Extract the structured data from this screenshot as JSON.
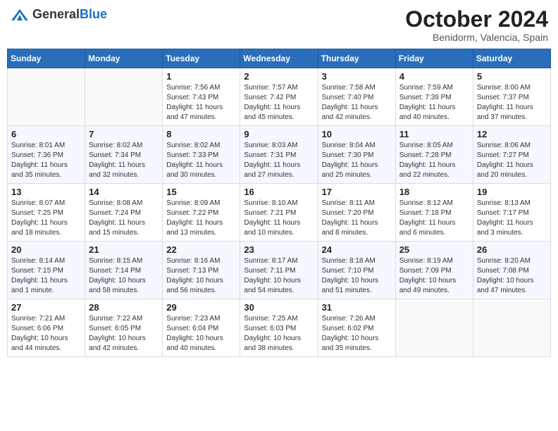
{
  "header": {
    "logo_general": "General",
    "logo_blue": "Blue",
    "month_title": "October 2024",
    "subtitle": "Benidorm, Valencia, Spain"
  },
  "weekdays": [
    "Sunday",
    "Monday",
    "Tuesday",
    "Wednesday",
    "Thursday",
    "Friday",
    "Saturday"
  ],
  "weeks": [
    [
      {
        "day": "",
        "info": ""
      },
      {
        "day": "",
        "info": ""
      },
      {
        "day": "1",
        "info": "Sunrise: 7:56 AM\nSunset: 7:43 PM\nDaylight: 11 hours and 47 minutes."
      },
      {
        "day": "2",
        "info": "Sunrise: 7:57 AM\nSunset: 7:42 PM\nDaylight: 11 hours and 45 minutes."
      },
      {
        "day": "3",
        "info": "Sunrise: 7:58 AM\nSunset: 7:40 PM\nDaylight: 11 hours and 42 minutes."
      },
      {
        "day": "4",
        "info": "Sunrise: 7:59 AM\nSunset: 7:39 PM\nDaylight: 11 hours and 40 minutes."
      },
      {
        "day": "5",
        "info": "Sunrise: 8:00 AM\nSunset: 7:37 PM\nDaylight: 11 hours and 37 minutes."
      }
    ],
    [
      {
        "day": "6",
        "info": "Sunrise: 8:01 AM\nSunset: 7:36 PM\nDaylight: 11 hours and 35 minutes."
      },
      {
        "day": "7",
        "info": "Sunrise: 8:02 AM\nSunset: 7:34 PM\nDaylight: 11 hours and 32 minutes."
      },
      {
        "day": "8",
        "info": "Sunrise: 8:02 AM\nSunset: 7:33 PM\nDaylight: 11 hours and 30 minutes."
      },
      {
        "day": "9",
        "info": "Sunrise: 8:03 AM\nSunset: 7:31 PM\nDaylight: 11 hours and 27 minutes."
      },
      {
        "day": "10",
        "info": "Sunrise: 8:04 AM\nSunset: 7:30 PM\nDaylight: 11 hours and 25 minutes."
      },
      {
        "day": "11",
        "info": "Sunrise: 8:05 AM\nSunset: 7:28 PM\nDaylight: 11 hours and 22 minutes."
      },
      {
        "day": "12",
        "info": "Sunrise: 8:06 AM\nSunset: 7:27 PM\nDaylight: 11 hours and 20 minutes."
      }
    ],
    [
      {
        "day": "13",
        "info": "Sunrise: 8:07 AM\nSunset: 7:25 PM\nDaylight: 11 hours and 18 minutes."
      },
      {
        "day": "14",
        "info": "Sunrise: 8:08 AM\nSunset: 7:24 PM\nDaylight: 11 hours and 15 minutes."
      },
      {
        "day": "15",
        "info": "Sunrise: 8:09 AM\nSunset: 7:22 PM\nDaylight: 11 hours and 13 minutes."
      },
      {
        "day": "16",
        "info": "Sunrise: 8:10 AM\nSunset: 7:21 PM\nDaylight: 11 hours and 10 minutes."
      },
      {
        "day": "17",
        "info": "Sunrise: 8:11 AM\nSunset: 7:20 PM\nDaylight: 11 hours and 8 minutes."
      },
      {
        "day": "18",
        "info": "Sunrise: 8:12 AM\nSunset: 7:18 PM\nDaylight: 11 hours and 6 minutes."
      },
      {
        "day": "19",
        "info": "Sunrise: 8:13 AM\nSunset: 7:17 PM\nDaylight: 11 hours and 3 minutes."
      }
    ],
    [
      {
        "day": "20",
        "info": "Sunrise: 8:14 AM\nSunset: 7:15 PM\nDaylight: 11 hours and 1 minute."
      },
      {
        "day": "21",
        "info": "Sunrise: 8:15 AM\nSunset: 7:14 PM\nDaylight: 10 hours and 58 minutes."
      },
      {
        "day": "22",
        "info": "Sunrise: 8:16 AM\nSunset: 7:13 PM\nDaylight: 10 hours and 56 minutes."
      },
      {
        "day": "23",
        "info": "Sunrise: 8:17 AM\nSunset: 7:11 PM\nDaylight: 10 hours and 54 minutes."
      },
      {
        "day": "24",
        "info": "Sunrise: 8:18 AM\nSunset: 7:10 PM\nDaylight: 10 hours and 51 minutes."
      },
      {
        "day": "25",
        "info": "Sunrise: 8:19 AM\nSunset: 7:09 PM\nDaylight: 10 hours and 49 minutes."
      },
      {
        "day": "26",
        "info": "Sunrise: 8:20 AM\nSunset: 7:08 PM\nDaylight: 10 hours and 47 minutes."
      }
    ],
    [
      {
        "day": "27",
        "info": "Sunrise: 7:21 AM\nSunset: 6:06 PM\nDaylight: 10 hours and 44 minutes."
      },
      {
        "day": "28",
        "info": "Sunrise: 7:22 AM\nSunset: 6:05 PM\nDaylight: 10 hours and 42 minutes."
      },
      {
        "day": "29",
        "info": "Sunrise: 7:23 AM\nSunset: 6:04 PM\nDaylight: 10 hours and 40 minutes."
      },
      {
        "day": "30",
        "info": "Sunrise: 7:25 AM\nSunset: 6:03 PM\nDaylight: 10 hours and 38 minutes."
      },
      {
        "day": "31",
        "info": "Sunrise: 7:26 AM\nSunset: 6:02 PM\nDaylight: 10 hours and 35 minutes."
      },
      {
        "day": "",
        "info": ""
      },
      {
        "day": "",
        "info": ""
      }
    ]
  ]
}
